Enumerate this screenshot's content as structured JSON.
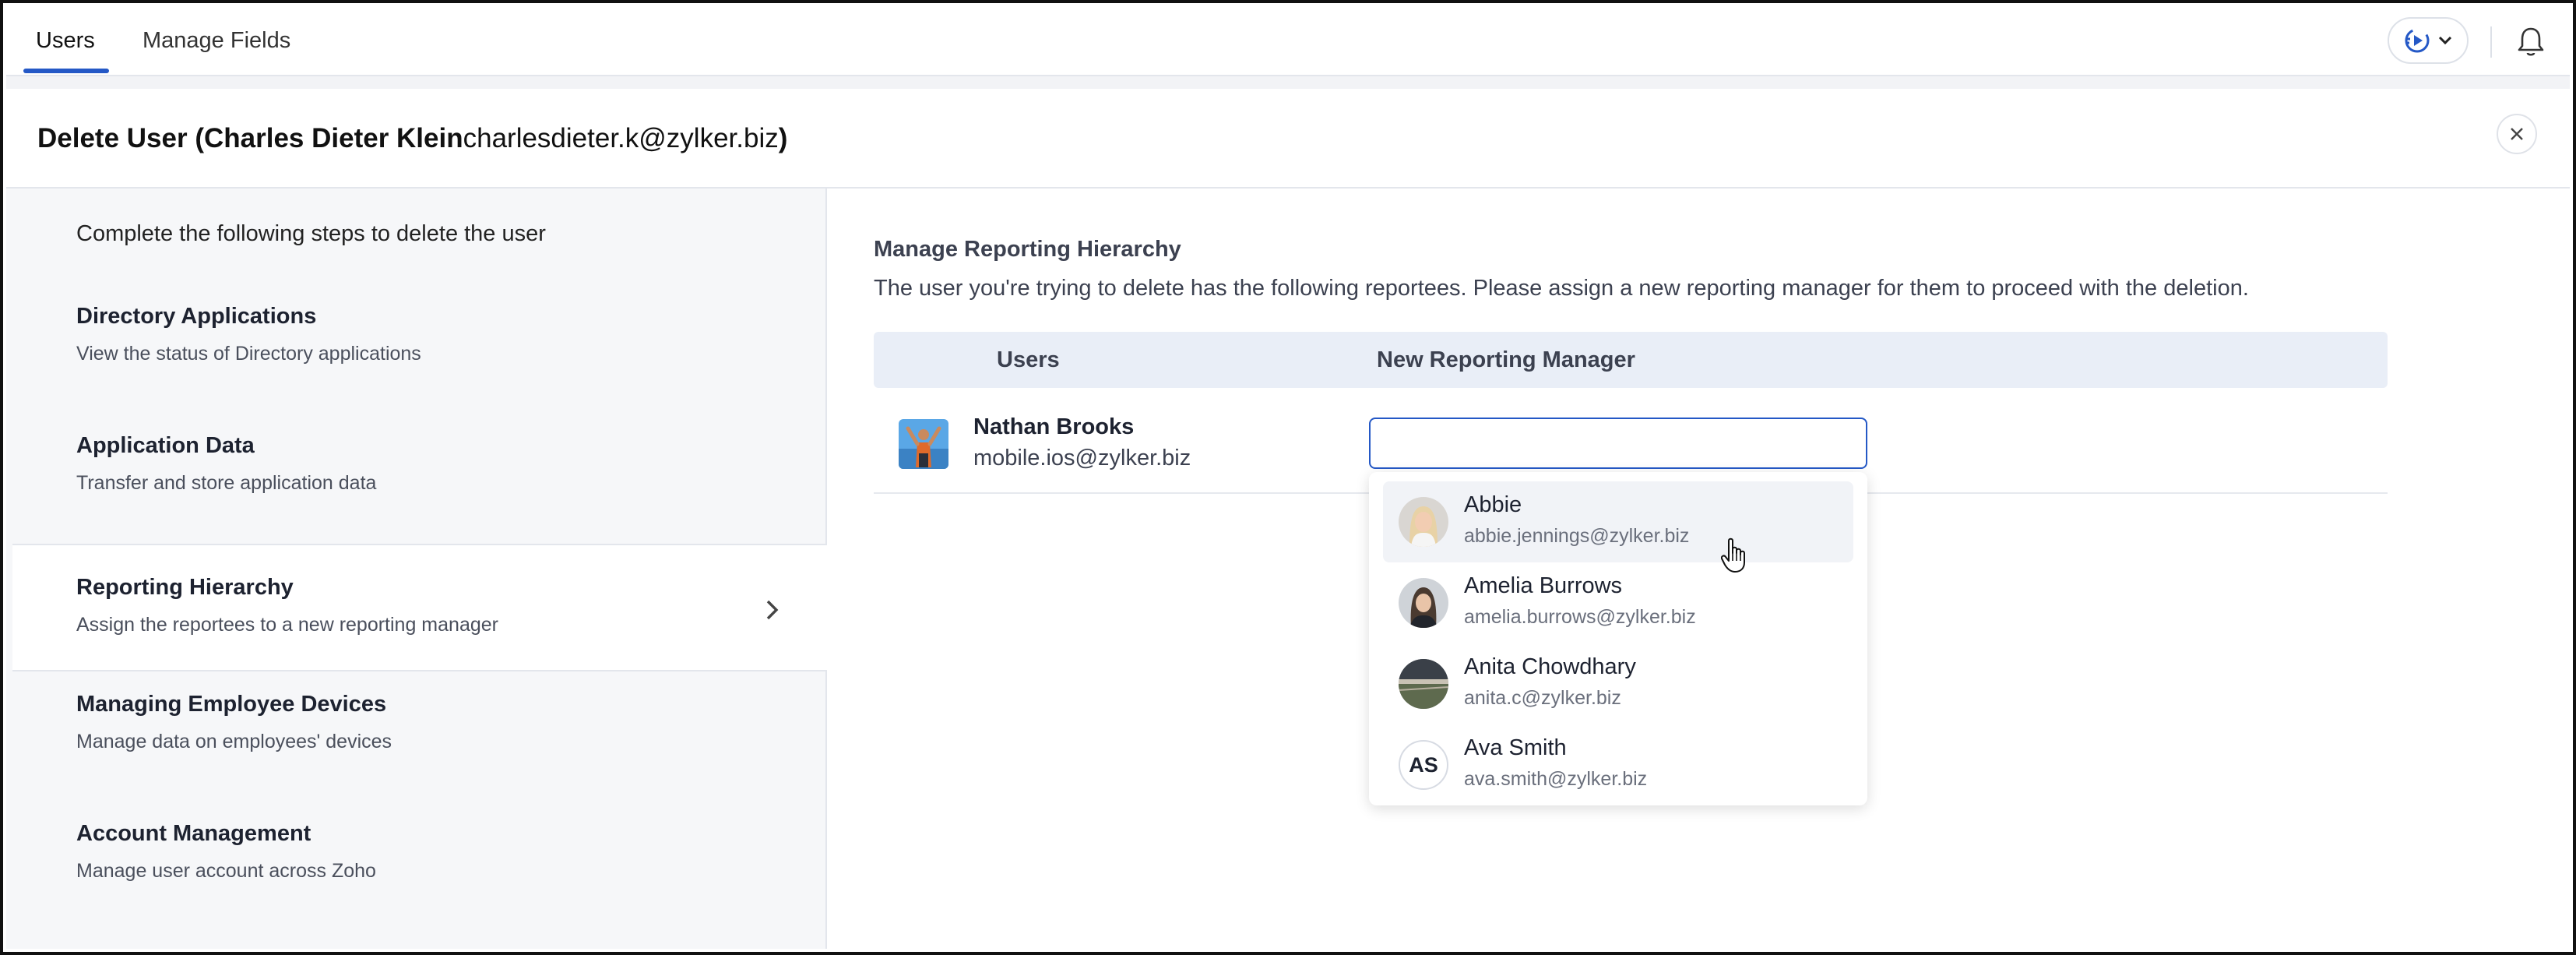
{
  "tabs": [
    {
      "label": "Users",
      "active": true
    },
    {
      "label": "Manage Fields",
      "active": false
    }
  ],
  "header_icons": {
    "assist": "assist-play-icon",
    "dropdown": "chevron-down-icon",
    "notifications": "bell-icon"
  },
  "dialog": {
    "title_prefix": "Delete User ( ",
    "user_name": "Charles Dieter Klein",
    "user_email": " charlesdieter.k@zylker.biz",
    "title_suffix": " )",
    "close_icon": "close-icon"
  },
  "steps_intro": "Complete the following steps to delete the user",
  "steps": [
    {
      "title": "Directory Applications",
      "desc": "View the status of Directory applications"
    },
    {
      "title": "Application Data",
      "desc": "Transfer and store application data"
    },
    {
      "title": "Reporting Hierarchy",
      "desc": "Assign the reportees to a new reporting manager",
      "active": true
    },
    {
      "title": "Managing Employee Devices",
      "desc": "Manage data on employees' devices"
    },
    {
      "title": "Account Management",
      "desc": "Manage user account across Zoho"
    }
  ],
  "content": {
    "title": "Manage Reporting Hierarchy",
    "description": "The user you're trying to delete has the following reportees. Please assign a new reporting manager for them to proceed with the deletion.",
    "col_users": "Users",
    "col_manager": "New Reporting Manager",
    "reportee": {
      "name": "Nathan Brooks",
      "email": "mobile.ios@zylker.biz"
    },
    "manager_input_value": ""
  },
  "dropdown_options": [
    {
      "name": "Abbie",
      "email": "abbie.jennings@zylker.biz",
      "hovered": true
    },
    {
      "name": "Amelia Burrows",
      "email": "amelia.burrows@zylker.biz"
    },
    {
      "name": "Anita Chowdhary",
      "email": "anita.c@zylker.biz"
    },
    {
      "name": "Ava Smith",
      "email": "ava.smith@zylker.biz",
      "initials": "AS"
    }
  ],
  "colors": {
    "accent": "#2458c6",
    "table_header": "#e9eef7",
    "sidebar": "#f6f7f9"
  }
}
